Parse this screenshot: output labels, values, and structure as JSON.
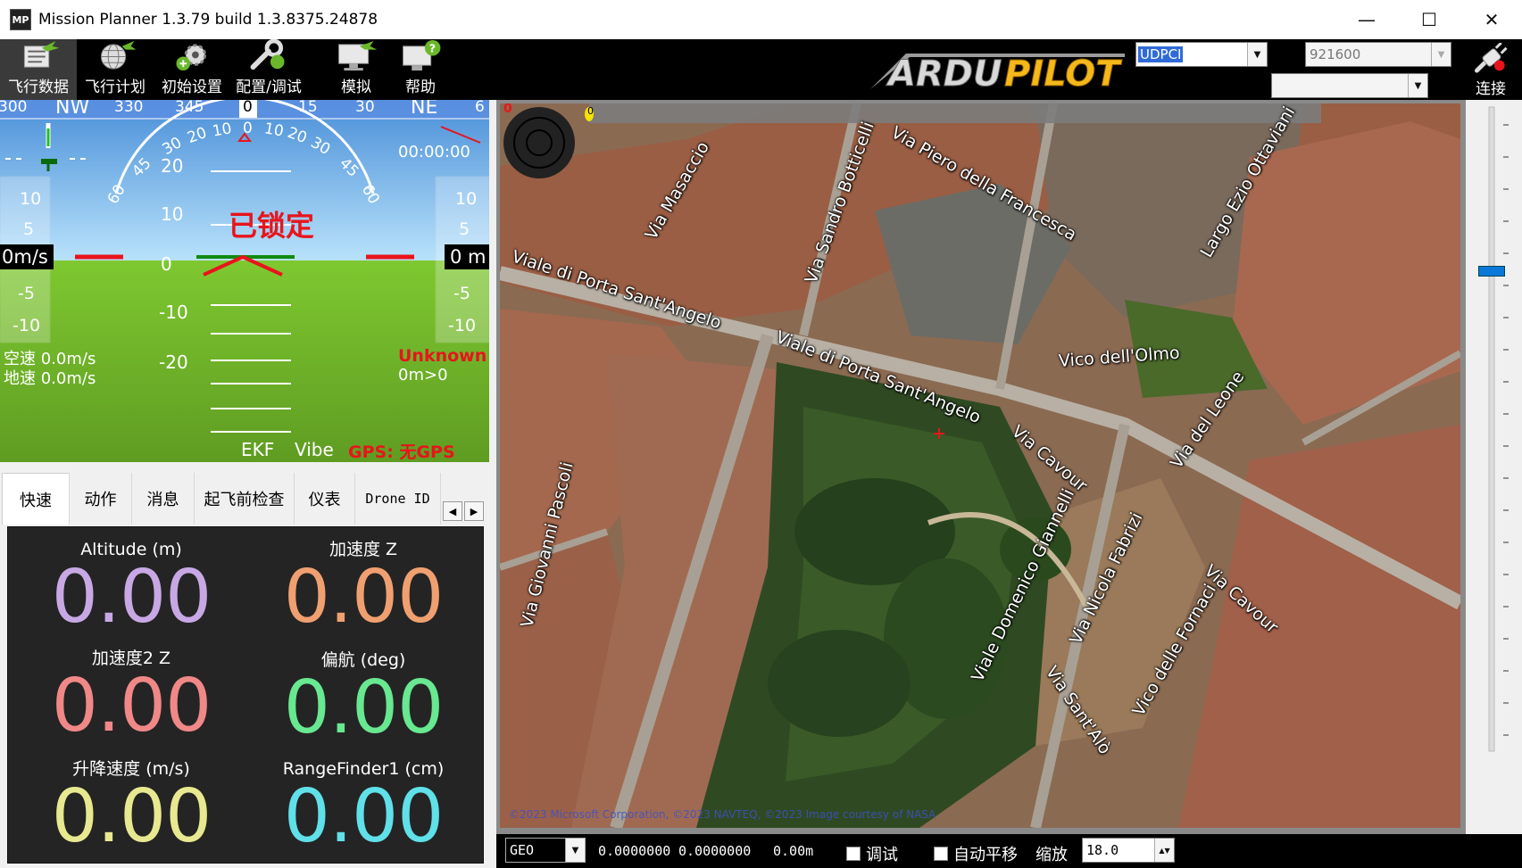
{
  "window": {
    "title": "Mission Planner 1.3.79 build 1.3.8375.24878",
    "icon_text": "MP",
    "minimize": "—",
    "maximize": "☐",
    "close": "✕"
  },
  "toolbar": {
    "buttons": [
      {
        "label": "飞行数据",
        "icon": "flight-data-icon"
      },
      {
        "label": "飞行计划",
        "icon": "flight-plan-icon"
      },
      {
        "label": "初始设置",
        "icon": "initial-setup-icon"
      },
      {
        "label": "配置/调试",
        "icon": "config-tuning-icon"
      },
      {
        "label": "模拟",
        "icon": "simulation-icon"
      },
      {
        "label": "帮助",
        "icon": "help-icon"
      }
    ],
    "logo": "ARDUPILOT",
    "port": "UDPCI",
    "baud": "921600",
    "connect_label": "连接"
  },
  "hud": {
    "heading_tape": [
      "300",
      "NW",
      "330",
      "345",
      "0",
      "15",
      "30",
      "NE",
      "6"
    ],
    "heading_value": "0",
    "timer": "00:00:00",
    "status": "已锁定",
    "pitch_labels": [
      "20",
      "10",
      "0",
      "-10",
      "-20"
    ],
    "roll_labels": [
      "60",
      "45",
      "30",
      "20",
      "10",
      "0",
      "10",
      "20",
      "30",
      "45",
      "60"
    ],
    "left_tape": [
      "10",
      "5",
      "-5",
      "-10"
    ],
    "right_tape": [
      "10",
      "5",
      "-5",
      "-10"
    ],
    "speed_box": "0m/s",
    "alt_box": "0 m",
    "airspeed": "空速 0.0m/s",
    "groundspeed": "地速 0.0m/s",
    "mode": "Unknown",
    "alt_mode": "0m>0",
    "ekf": "EKF",
    "vibe": "Vibe",
    "gps": "GPS: 无GPS",
    "colors": {
      "sky": "#86c7f0",
      "ground": "#7cc02c",
      "warning": "#e8141c"
    }
  },
  "tabs": {
    "items": [
      "快速",
      "动作",
      "消息",
      "起飞前检查",
      "仪表",
      "Drone ID"
    ],
    "active": 0,
    "prev": "◀",
    "next": "▶"
  },
  "quick": [
    {
      "label": "Altitude (m)",
      "value": "0.00",
      "color": "#c8a8e4"
    },
    {
      "label": "加速度 Z",
      "value": "0.00",
      "color": "#f0a070"
    },
    {
      "label": "加速度2 Z",
      "value": "0.00",
      "color": "#f08888"
    },
    {
      "label": "偏航 (deg)",
      "value": "0.00",
      "color": "#68e890"
    },
    {
      "label": "升降速度 (m/s)",
      "value": "0.00",
      "color": "#e8e890"
    },
    {
      "label": "RangeFinder1 (cm)",
      "value": "0.00",
      "color": "#60e0e8"
    }
  ],
  "map": {
    "streets": [
      "Via Piero della Francesca",
      "Largo Ezio Ottaviani",
      "Via Masaccio",
      "Via Sandro Botticelli",
      "Viale di Porta Sant'Angelo",
      "Viale di Porta Sant'Angelo",
      "Vico dell'Olmo",
      "Via Cavour",
      "Via del Leone",
      "Via Giovanni Pascoli",
      "Viale Domenico Giannelli",
      "Via Nicola Fabrizi",
      "Via Cavour",
      "Vico delle Fornaci",
      "Via Sant'Alò"
    ],
    "credits": "©2023 Microsoft Corporation, ©2023 NAVTEQ, ©2023 Image courtesy of NASA",
    "overlay_value": "0"
  },
  "mapstatus": {
    "coord_system": "GEO",
    "lat": "0.0000000",
    "lng": "0.0000000",
    "alt": "0.00m",
    "debug_label": "调试",
    "autopan_label": "自动平移",
    "zoom_label": "缩放",
    "zoom_value": "18.0"
  }
}
